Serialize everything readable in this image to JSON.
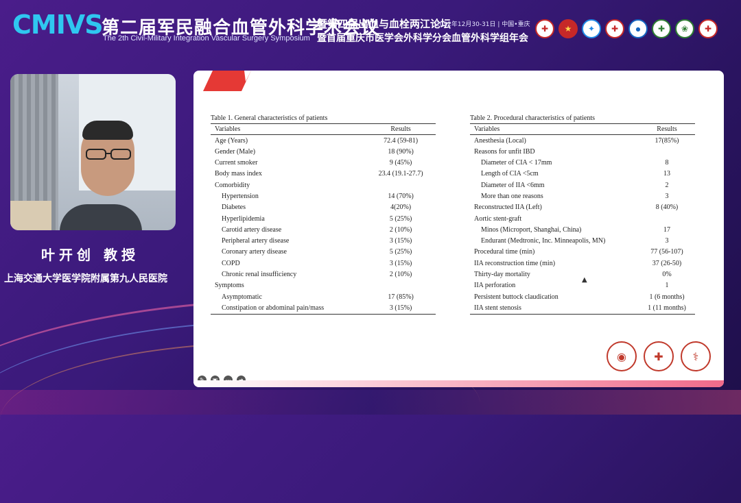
{
  "header": {
    "logo": "CMIVS",
    "title_cn": "第二届军民融合血管外科学术会议",
    "title_en": "The 2th Civil-Military Integration Vascular Surgery Symposium",
    "subtitle1": "暨第四届出血与血栓两江论坛",
    "date": "2022年12月30-31日 | 中国•重庆",
    "subtitle2": "暨首届重庆市医学会外科学分会血管外科学组年会"
  },
  "speaker": {
    "name": "叶开创 教授",
    "org": "上海交通大学医学院附属第九人民医院"
  },
  "table1": {
    "caption": "Table 1. General characteristics of patients",
    "col_var": "Variables",
    "col_res": "Results",
    "rows": [
      {
        "label": "Age (Years)",
        "value": "72.4 (59-81)",
        "indent": false
      },
      {
        "label": "Gender (Male)",
        "value": "18 (90%)",
        "indent": false
      },
      {
        "label": "Current smoker",
        "value": "9 (45%)",
        "indent": false
      },
      {
        "label": "Body mass index",
        "value": "23.4 (19.1-27.7)",
        "indent": false
      },
      {
        "label": "Comorbidity",
        "value": "",
        "indent": false
      },
      {
        "label": "Hypertension",
        "value": "14 (70%)",
        "indent": true
      },
      {
        "label": "Diabetes",
        "value": "4(20%)",
        "indent": true
      },
      {
        "label": "Hyperlipidemia",
        "value": "5 (25%)",
        "indent": true
      },
      {
        "label": "Carotid artery disease",
        "value": "2 (10%)",
        "indent": true
      },
      {
        "label": "Peripheral artery disease",
        "value": "3 (15%)",
        "indent": true
      },
      {
        "label": "Coronary artery disease",
        "value": "5 (25%)",
        "indent": true
      },
      {
        "label": "COPD",
        "value": "3 (15%)",
        "indent": true
      },
      {
        "label": "Chronic renal insufficiency",
        "value": "2 (10%)",
        "indent": true
      },
      {
        "label": "Symptoms",
        "value": "",
        "indent": false
      },
      {
        "label": "Asymptomatic",
        "value": "17 (85%)",
        "indent": true
      },
      {
        "label": "Constipation or abdominal pain/mass",
        "value": "3 (15%)",
        "indent": true
      }
    ]
  },
  "table2": {
    "caption": "Table 2. Procedural characteristics of patients",
    "col_var": "Variables",
    "col_res": "Results",
    "rows": [
      {
        "label": "Anesthesia (Local)",
        "value": "17(85%)",
        "indent": false
      },
      {
        "label": "Reasons for unfit IBD",
        "value": "",
        "indent": false
      },
      {
        "label": "Diameter of CIA < 17mm",
        "value": "8",
        "indent": true
      },
      {
        "label": "Length of CIA <5cm",
        "value": "13",
        "indent": true
      },
      {
        "label": "Diameter of IIA <6mm",
        "value": "2",
        "indent": true
      },
      {
        "label": "More than one reasons",
        "value": "3",
        "indent": true
      },
      {
        "label": "Reconstructed IIA (Left)",
        "value": "8 (40%)",
        "indent": false
      },
      {
        "label": "Aortic stent-graft",
        "value": "",
        "indent": false
      },
      {
        "label": "Minos (Microport, Shanghai, China)",
        "value": "17",
        "indent": true
      },
      {
        "label": "Endurant (Medtronic, Inc. Minneapolis, MN)",
        "value": "3",
        "indent": true
      },
      {
        "label": "Procedural time (min)",
        "value": "77 (56-107)",
        "indent": false
      },
      {
        "label": "IIA reconstruction time (min)",
        "value": "37 (26-50)",
        "indent": false
      },
      {
        "label": "Thirty-day mortality",
        "value": "0%",
        "indent": false
      },
      {
        "label": "IIA perforation",
        "value": "1",
        "indent": false
      },
      {
        "label": "Persistent buttock claudication",
        "value": "1 (6 months)",
        "indent": false
      },
      {
        "label": "IIA stent stenosis",
        "value": "1 (11 months)",
        "indent": false
      }
    ]
  },
  "icons": {
    "badges": [
      "medical-society-badge",
      "chinese-emblem-badge",
      "eagle-badge",
      "hospital-badge",
      "siac-badge",
      "cross-badge",
      "association-badge",
      "star-badge"
    ],
    "emblems": [
      "university-seal",
      "medical-emblem",
      "caduceus-emblem"
    ],
    "controls": [
      "pen-icon",
      "cc-icon",
      "more-icon",
      "forward-icon"
    ]
  },
  "colors": {
    "accent": "#2fc7f0",
    "background": "#3a1a7a",
    "slide_red": "#e53935"
  }
}
